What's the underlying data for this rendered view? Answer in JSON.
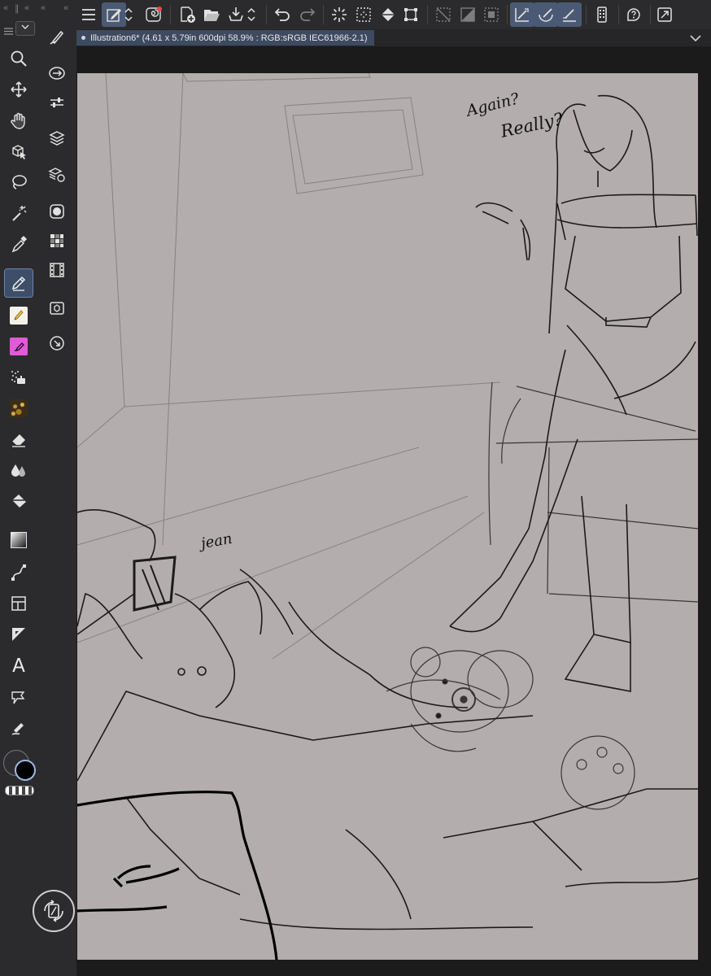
{
  "document": {
    "tab_title": "Illustration6* (4.61 x 5.79in 600dpi 58.9% : RGB:sRGB IEC61966-2.1)"
  },
  "left_toolbar": {
    "tools": [
      {
        "name": "zoom",
        "icon": "magnifier-icon"
      },
      {
        "name": "move",
        "icon": "move-arrows-icon"
      },
      {
        "name": "hand",
        "icon": "hand-icon"
      },
      {
        "name": "operation",
        "icon": "object-select-icon"
      },
      {
        "name": "lasso",
        "icon": "lasso-icon"
      },
      {
        "name": "auto-select",
        "icon": "magic-wand-icon"
      },
      {
        "name": "eyedropper",
        "icon": "eyedropper-icon"
      },
      {
        "name": "pen",
        "icon": "pen-icon",
        "active": true
      },
      {
        "name": "pencil",
        "icon": "pencil-brush-icon"
      },
      {
        "name": "brush",
        "icon": "brush-icon"
      },
      {
        "name": "airbrush",
        "icon": "airbrush-icon"
      },
      {
        "name": "decoration",
        "icon": "decoration-icon"
      },
      {
        "name": "eraser",
        "icon": "eraser-icon"
      },
      {
        "name": "blend",
        "icon": "blend-drops-icon"
      },
      {
        "name": "fill",
        "icon": "fill-bucket-icon"
      },
      {
        "name": "gradient",
        "icon": "gradient-icon"
      },
      {
        "name": "figure",
        "icon": "curve-node-icon"
      },
      {
        "name": "frame",
        "icon": "frame-border-icon"
      },
      {
        "name": "ruler",
        "icon": "ruler-triangle-icon"
      },
      {
        "name": "text",
        "icon": "text-icon",
        "glyph": "A"
      },
      {
        "name": "balloon",
        "icon": "balloon-icon"
      },
      {
        "name": "correct-line",
        "icon": "correct-line-icon"
      }
    ]
  },
  "colors": {
    "main": "#000000",
    "sub": "#2f2f31",
    "active_tool": "#3e4e68",
    "toolbar_active": "#4b5a74",
    "canvas": "#b4adad"
  },
  "canvas_text": {
    "note_1": "Again?",
    "note_2": "Really?",
    "note_3": "jean"
  }
}
